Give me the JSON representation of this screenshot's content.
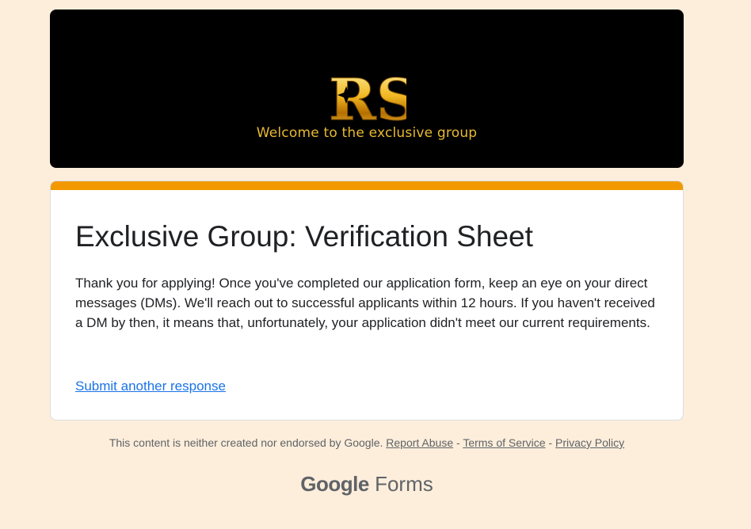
{
  "banner": {
    "logo_text": "RS",
    "tagline": "Welcome to the exclusive group",
    "logo_icon": "rs-gold-logo"
  },
  "form": {
    "title": "Exclusive Group: Verification Sheet",
    "confirmation_message": "Thank you for applying! Once you've completed our application form, keep an eye on your direct messages (DMs). We'll reach out to successful applicants within 12 hours. If you haven't received a DM by then, it means that, unfortunately, your application didn't meet our current requirements.",
    "submit_another_label": "Submit another response",
    "accent_color": "#f29900"
  },
  "footer": {
    "disclaimer": "This content is neither created nor endorsed by Google.",
    "report_abuse": "Report Abuse",
    "separator": "-",
    "terms": "Terms of Service",
    "privacy": "Privacy Policy",
    "brand_google": "Google",
    "brand_forms": "Forms"
  },
  "colors": {
    "background": "#fdeedb",
    "link": "#1a73e8",
    "gold": "#e8b931"
  }
}
